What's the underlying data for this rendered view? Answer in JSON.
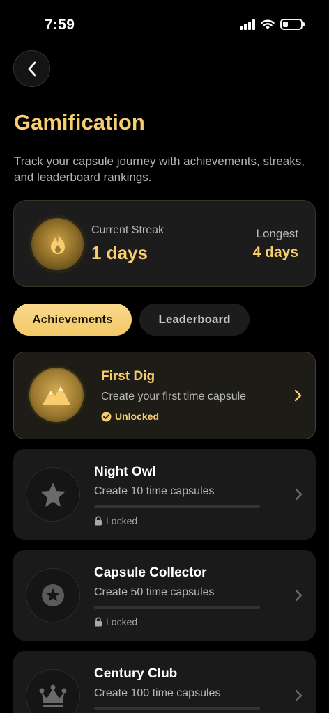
{
  "status_bar": {
    "time": "7:59"
  },
  "page": {
    "title": "Gamification",
    "subtitle": "Track your capsule journey with achievements, streaks, and leaderboard rankings."
  },
  "streak": {
    "current_label": "Current Streak",
    "current_value": "1 days",
    "longest_label": "Longest",
    "longest_value": "4 days"
  },
  "tabs": [
    {
      "label": "Achievements",
      "active": true
    },
    {
      "label": "Leaderboard",
      "active": false
    }
  ],
  "achievements": [
    {
      "title": "First Dig",
      "description": "Create your first time capsule",
      "status": "Unlocked",
      "icon": "mountains-icon",
      "progress": 1.0
    },
    {
      "title": "Night Owl",
      "description": "Create 10 time capsules",
      "status": "Locked",
      "icon": "star-icon",
      "progress": 0.0
    },
    {
      "title": "Capsule Collector",
      "description": "Create 50 time capsules",
      "status": "Locked",
      "icon": "star-badge-icon",
      "progress": 0.0
    },
    {
      "title": "Century Club",
      "description": "Create 100 time capsules",
      "status": "Locked",
      "icon": "crown-icon",
      "progress": 0.0
    }
  ],
  "colors": {
    "accent": "#f7cd6d",
    "background": "#000000",
    "card": "#1a1a1a"
  }
}
